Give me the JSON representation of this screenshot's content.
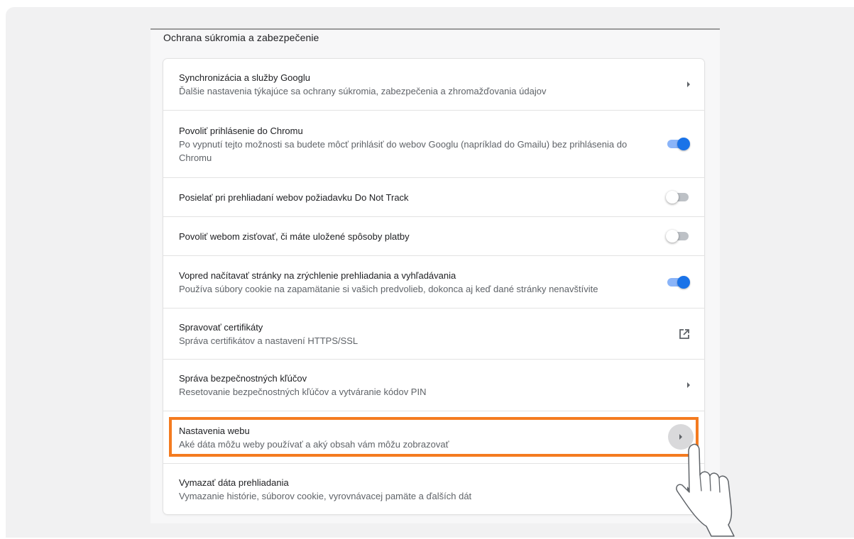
{
  "section": {
    "title": "Ochrana súkromia a zabezpečenie"
  },
  "rows": [
    {
      "title": "Synchronizácia a služby Googlu",
      "subtitle": "Ďalšie nastavenia týkajúce sa ochrany súkromia, zabezpečenia a zhromažďovania údajov",
      "control": "arrow"
    },
    {
      "title": "Povoliť prihlásenie do Chromu",
      "subtitle": "Po vypnutí tejto možnosti sa budete môcť prihlásiť do webov Googlu (napríklad do Gmailu) bez prihlásenia do Chromu",
      "control": "toggle",
      "checked": true
    },
    {
      "title": "Posielať pri prehliadaní webov požiadavku Do Not Track",
      "control": "toggle",
      "checked": false
    },
    {
      "title": "Povoliť webom zisťovať, či máte uložené spôsoby platby",
      "control": "toggle",
      "checked": false
    },
    {
      "title": "Vopred načítavať stránky na zrýchlenie prehliadania a vyhľadávania",
      "subtitle": "Používa súbory cookie na zapamätanie si vašich predvolieb, dokonca aj keď dané stránky nenavštívite",
      "control": "toggle",
      "checked": true
    },
    {
      "title": "Spravovať certifikáty",
      "subtitle": "Správa certifikátov a nastavení HTTPS/SSL",
      "control": "external-link-icon"
    },
    {
      "title": "Správa bezpečnostných kľúčov",
      "subtitle": "Resetovanie bezpečnostných kľúčov a vytváranie kódov PIN",
      "control": "arrow"
    },
    {
      "title": "Nastavenia webu",
      "subtitle": "Aké dáta môžu weby používať a aký obsah vám môžu zobrazovať",
      "control": "arrow",
      "highlighted": true
    },
    {
      "title": "Vymazať dáta prehliadania",
      "subtitle": "Vymazanie histórie, súborov cookie, vyrovnávacej pamäte a ďalších dát",
      "control": "arrow"
    }
  ],
  "colors": {
    "accent": "#1a73e8",
    "highlight": "#f47b20"
  },
  "overlay": {
    "pointer": "hand-pointer-icon"
  }
}
